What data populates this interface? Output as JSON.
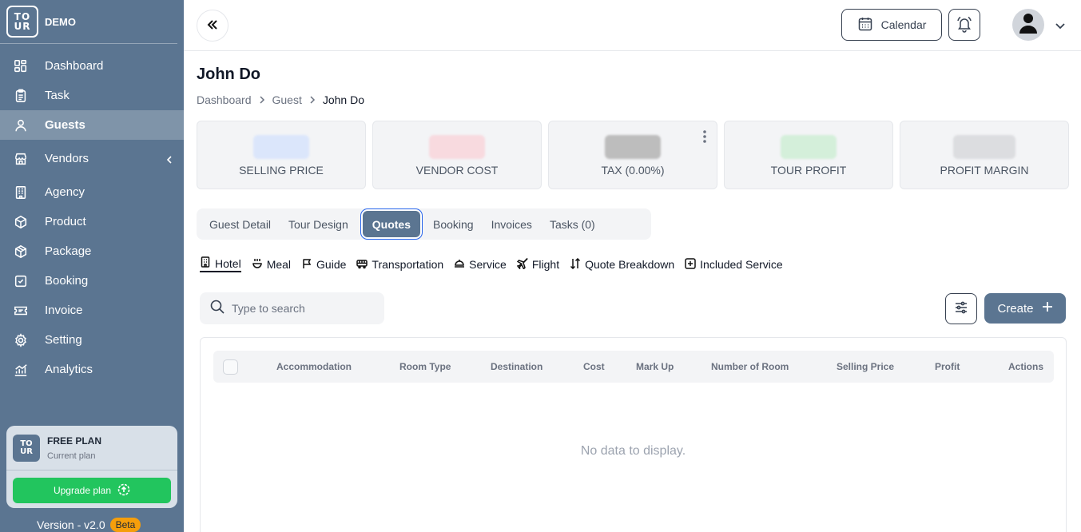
{
  "brand": {
    "logo_line1": "TO",
    "logo_line2": "UR",
    "name": "DEMO"
  },
  "sidebar": {
    "items": [
      {
        "label": "Dashboard",
        "icon": "dashboard-icon"
      },
      {
        "label": "Task",
        "icon": "clipboard-icon"
      },
      {
        "label": "Guests",
        "icon": "user-icon",
        "active": true
      },
      {
        "label": "Vendors",
        "icon": "store-icon",
        "has_submenu": true
      },
      {
        "label": "Agency",
        "icon": "building-icon"
      },
      {
        "label": "Product",
        "icon": "box-icon"
      },
      {
        "label": "Package",
        "icon": "package-icon"
      },
      {
        "label": "Booking",
        "icon": "booking-icon"
      },
      {
        "label": "Invoice",
        "icon": "ticket-icon"
      },
      {
        "label": "Setting",
        "icon": "gear-icon"
      },
      {
        "label": "Analytics",
        "icon": "chart-icon"
      }
    ]
  },
  "plan": {
    "title": "FREE PLAN",
    "subtitle": "Current plan",
    "upgrade_label": "Upgrade plan",
    "version": "Version - v2.0",
    "badge": "Beta"
  },
  "header": {
    "calendar_label": "Calendar"
  },
  "page": {
    "title": "John Do",
    "breadcrumb": [
      "Dashboard",
      "Guest",
      "John Do"
    ]
  },
  "cards": [
    {
      "label": "SELLING PRICE",
      "color": "#dbe6fb"
    },
    {
      "label": "VENDOR COST",
      "color": "#f8dadf"
    },
    {
      "label": "TAX (0.00%)",
      "color": "#bdbdbd"
    },
    {
      "label": "TOUR PROFIT",
      "color": "#d4efda"
    },
    {
      "label": "PROFIT MARGIN",
      "color": "#dcdde0"
    }
  ],
  "tabs": [
    "Guest Detail",
    "Tour Design",
    "Quotes",
    "Booking",
    "Invoices",
    "Tasks (0)"
  ],
  "active_tab": "Quotes",
  "subtabs": [
    {
      "label": "Hotel",
      "icon": "hotel-icon"
    },
    {
      "label": "Meal",
      "icon": "meal-icon"
    },
    {
      "label": "Guide",
      "icon": "flag-icon"
    },
    {
      "label": "Transportation",
      "icon": "bus-icon"
    },
    {
      "label": "Service",
      "icon": "service-icon"
    },
    {
      "label": "Flight",
      "icon": "plane-icon"
    },
    {
      "label": "Quote Breakdown",
      "icon": "sort-icon"
    },
    {
      "label": "Included Service",
      "icon": "plus-square-icon"
    }
  ],
  "search": {
    "placeholder": "Type to search"
  },
  "create_label": "Create",
  "table": {
    "columns": [
      "Accommodation",
      "Room Type",
      "Destination",
      "Cost",
      "Mark Up",
      "Number of Room",
      "Selling Price",
      "Profit",
      "Actions"
    ],
    "empty_text": "No data to display."
  }
}
